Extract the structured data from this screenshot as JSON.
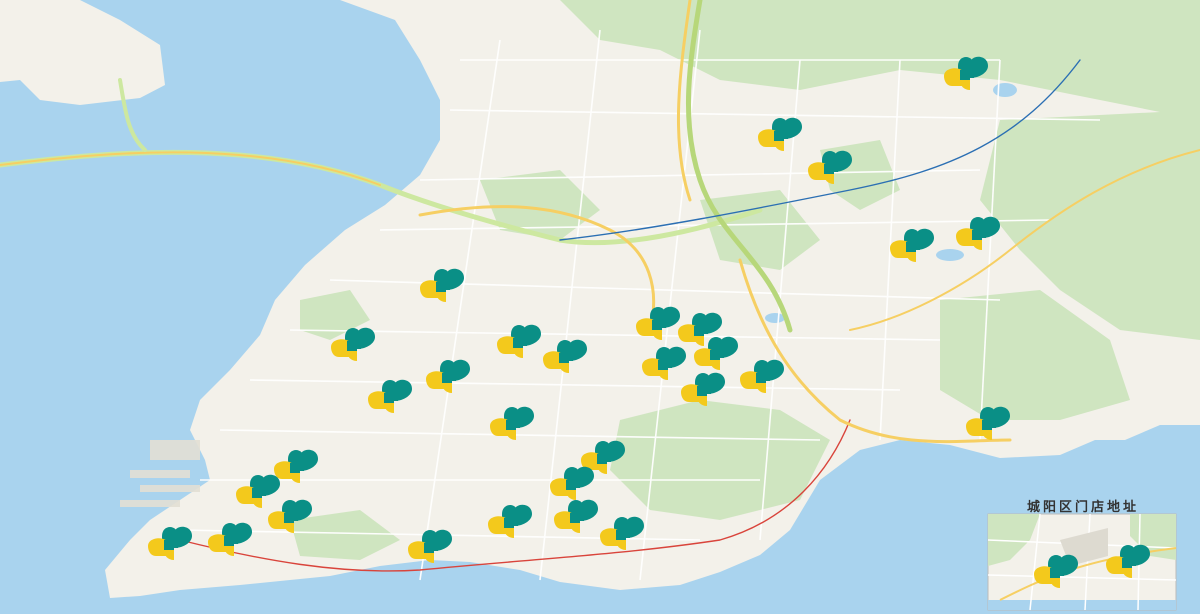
{
  "map": {
    "colors": {
      "sea": "#a9d3ee",
      "land": "#f3f1ea",
      "green": "#cfe5c0",
      "road_major": "#f6cf63",
      "road_minor": "#ffffff",
      "marker_teal": "#0a8f86",
      "marker_yellow": "#f3c91c"
    },
    "marker_icon": "store-location-marker-icon",
    "inset": {
      "title": "城阳区门店地址"
    }
  }
}
